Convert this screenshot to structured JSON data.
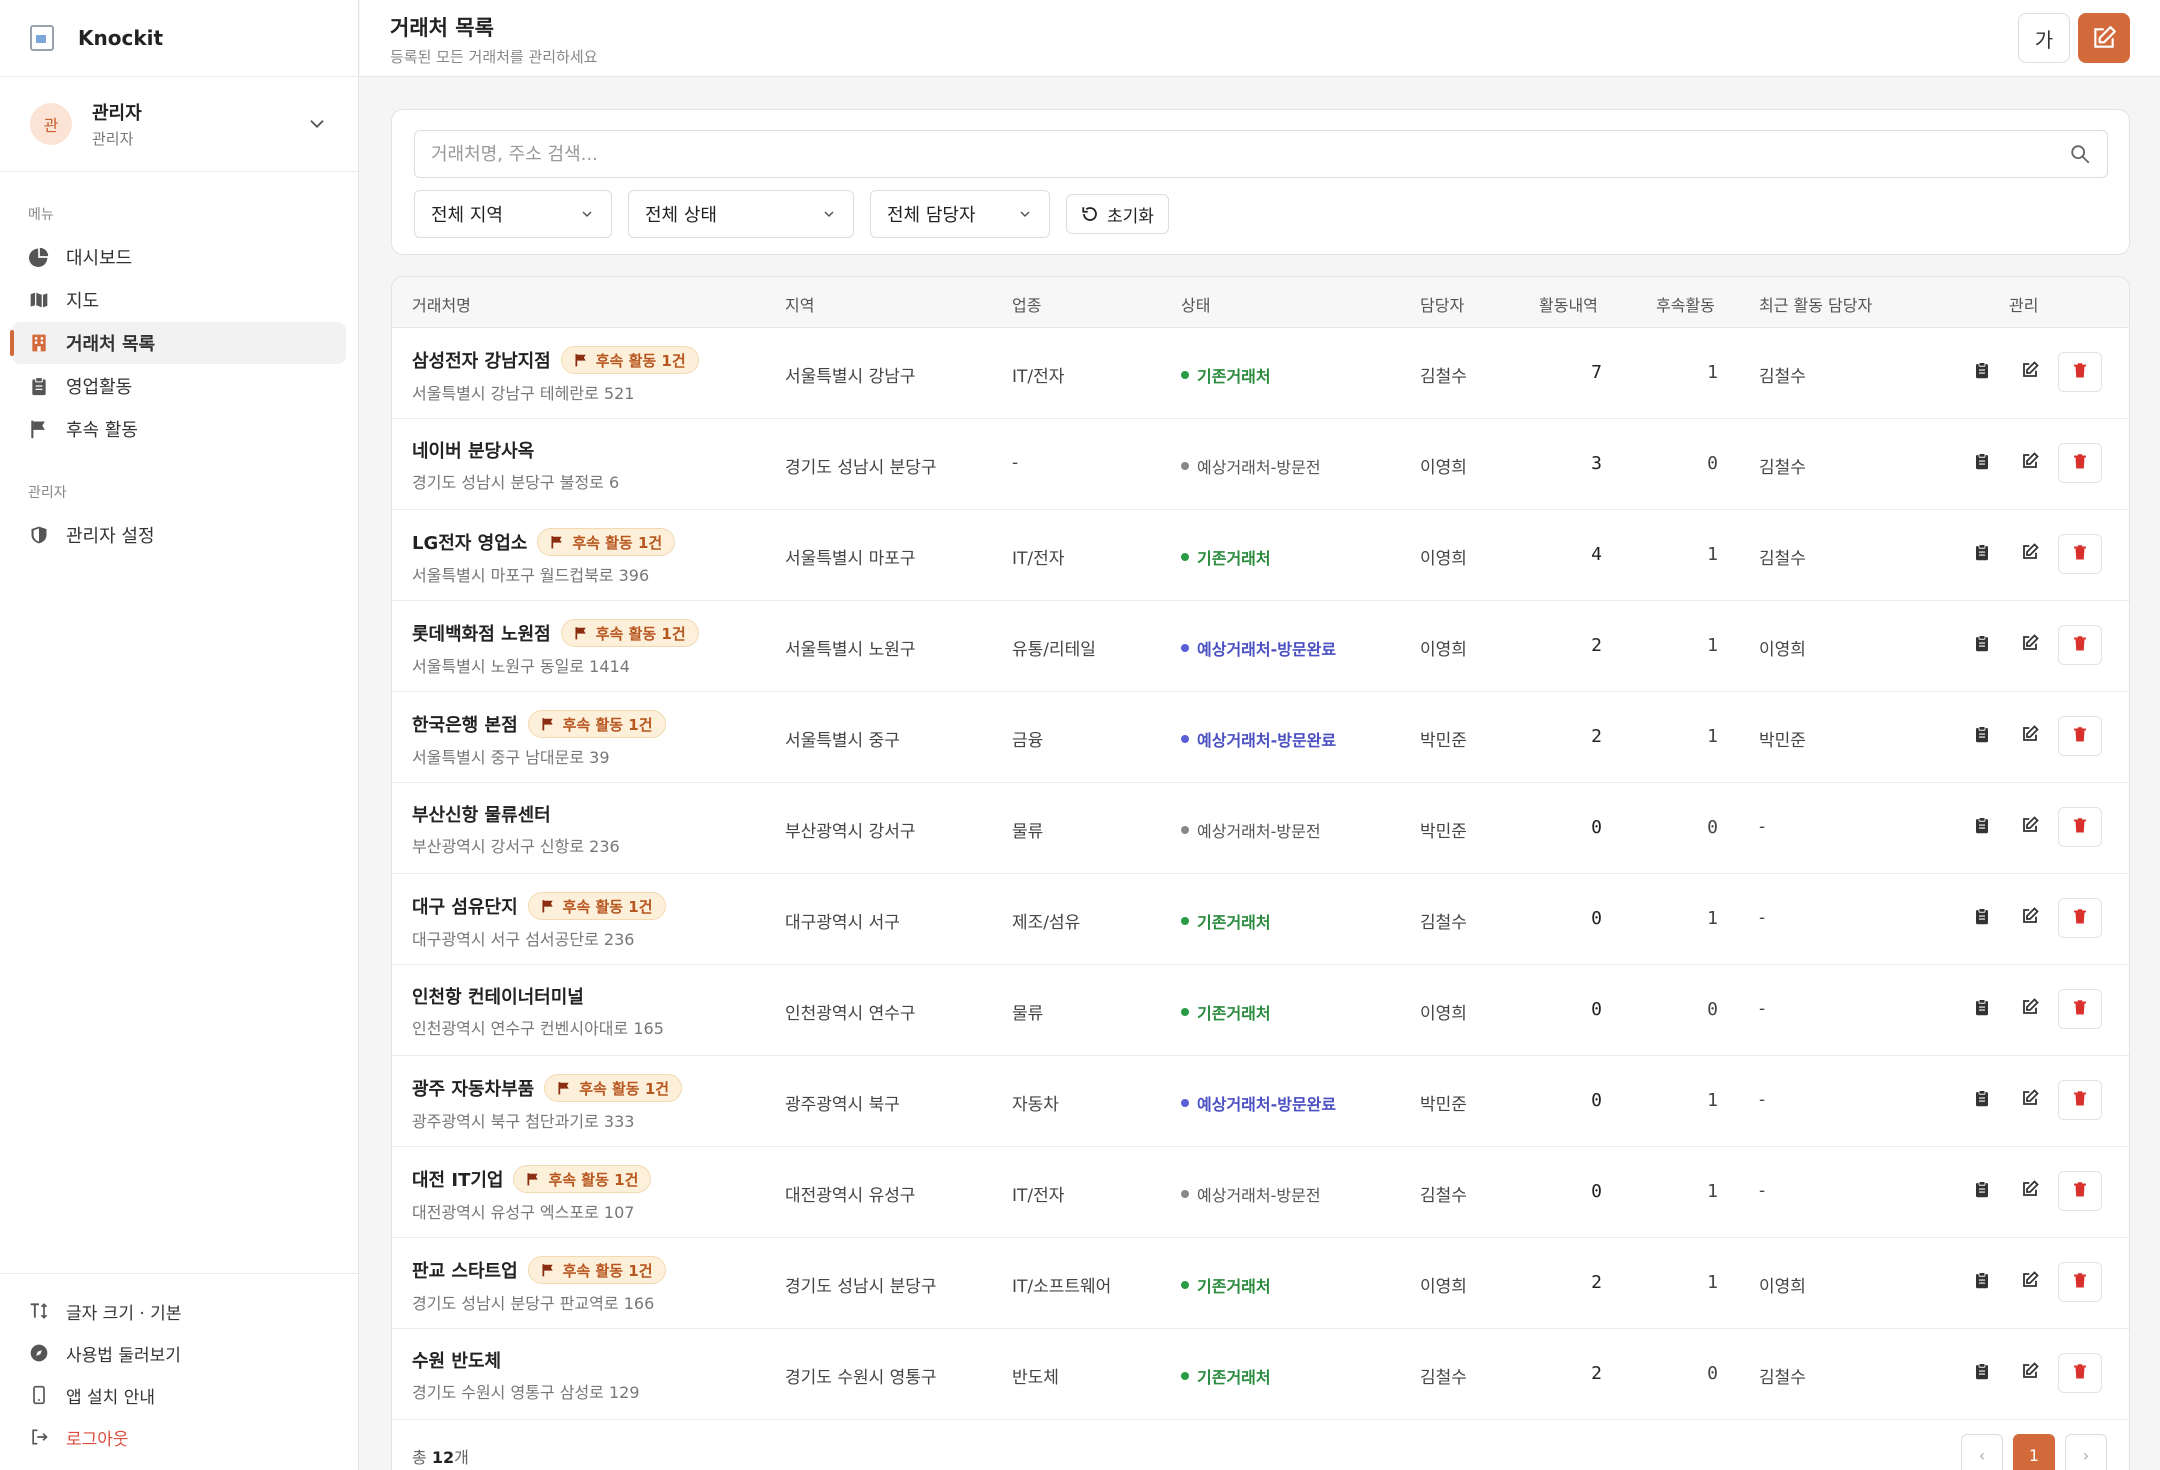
{
  "brand": {
    "name": "Knockit"
  },
  "user": {
    "avatar": "관",
    "name": "관리자",
    "role": "관리자"
  },
  "sidebar": {
    "menu_label": "메뉴",
    "admin_label": "관리자",
    "items": [
      {
        "label": "대시보드",
        "icon": "pie-chart-icon"
      },
      {
        "label": "지도",
        "icon": "map-icon"
      },
      {
        "label": "거래처 목록",
        "icon": "building-icon",
        "active": true
      },
      {
        "label": "영업활동",
        "icon": "clipboard-icon"
      },
      {
        "label": "후속 활동",
        "icon": "flag-icon"
      }
    ],
    "admin_items": [
      {
        "label": "관리자 설정",
        "icon": "shield-icon"
      }
    ],
    "bottom": [
      {
        "label": "글자 크기 · 기본",
        "icon": "text-size-icon"
      },
      {
        "label": "사용법 둘러보기",
        "icon": "compass-icon"
      },
      {
        "label": "앱 설치 안내",
        "icon": "phone-icon"
      },
      {
        "label": "로그아웃",
        "icon": "logout-icon"
      }
    ]
  },
  "header": {
    "title": "거래처 목록",
    "subtitle": "등록된 모든 거래처를 관리하세요",
    "font_button": "가"
  },
  "filters": {
    "search_placeholder": "거래처명, 주소 검색...",
    "region": "전체 지역",
    "status": "전체 상태",
    "manager": "전체 담당자",
    "reset": "초기화"
  },
  "table": {
    "columns": [
      "거래처명",
      "지역",
      "업종",
      "상태",
      "담당자",
      "활동내역",
      "후속활동",
      "최근 활동 담당자",
      "관리"
    ],
    "badge_text": "후속 활동 1건",
    "rows": [
      {
        "name": "삼성전자 강남지점",
        "badge": true,
        "address": "서울특별시 강남구 테헤란로 521",
        "region": "서울특별시 강남구",
        "industry": "IT/전자",
        "status": "기존거래처",
        "status_type": "green",
        "manager": "김철수",
        "activity": "7",
        "followup": "1",
        "recent": "김철수"
      },
      {
        "name": "네이버 분당사옥",
        "badge": false,
        "address": "경기도 성남시 분당구 불정로 6",
        "region": "경기도 성남시 분당구",
        "industry": "-",
        "status": "예상거래처-방문전",
        "status_type": "gray",
        "manager": "이영희",
        "activity": "3",
        "followup": "0",
        "recent": "김철수"
      },
      {
        "name": "LG전자 영업소",
        "badge": true,
        "address": "서울특별시 마포구 월드컵북로 396",
        "region": "서울특별시 마포구",
        "industry": "IT/전자",
        "status": "기존거래처",
        "status_type": "green",
        "manager": "이영희",
        "activity": "4",
        "followup": "1",
        "recent": "김철수"
      },
      {
        "name": "롯데백화점 노원점",
        "badge": true,
        "address": "서울특별시 노원구 동일로 1414",
        "region": "서울특별시 노원구",
        "industry": "유통/리테일",
        "status": "예상거래처-방문완료",
        "status_type": "blue",
        "manager": "이영희",
        "activity": "2",
        "followup": "1",
        "recent": "이영희"
      },
      {
        "name": "한국은행 본점",
        "badge": true,
        "address": "서울특별시 중구 남대문로 39",
        "region": "서울특별시 중구",
        "industry": "금융",
        "status": "예상거래처-방문완료",
        "status_type": "blue",
        "manager": "박민준",
        "activity": "2",
        "followup": "1",
        "recent": "박민준"
      },
      {
        "name": "부산신항 물류센터",
        "badge": false,
        "address": "부산광역시 강서구 신항로 236",
        "region": "부산광역시 강서구",
        "industry": "물류",
        "status": "예상거래처-방문전",
        "status_type": "gray",
        "manager": "박민준",
        "activity": "0",
        "followup": "0",
        "recent": "-"
      },
      {
        "name": "대구 섬유단지",
        "badge": true,
        "address": "대구광역시 서구 섬서공단로 236",
        "region": "대구광역시 서구",
        "industry": "제조/섬유",
        "status": "기존거래처",
        "status_type": "green",
        "manager": "김철수",
        "activity": "0",
        "followup": "1",
        "recent": "-"
      },
      {
        "name": "인천항 컨테이너터미널",
        "badge": false,
        "address": "인천광역시 연수구 컨벤시아대로 165",
        "region": "인천광역시 연수구",
        "industry": "물류",
        "status": "기존거래처",
        "status_type": "green",
        "manager": "이영희",
        "activity": "0",
        "followup": "0",
        "recent": "-"
      },
      {
        "name": "광주 자동차부품",
        "badge": true,
        "address": "광주광역시 북구 첨단과기로 333",
        "region": "광주광역시 북구",
        "industry": "자동차",
        "status": "예상거래처-방문완료",
        "status_type": "blue",
        "manager": "박민준",
        "activity": "0",
        "followup": "1",
        "recent": "-"
      },
      {
        "name": "대전 IT기업",
        "badge": true,
        "address": "대전광역시 유성구 엑스포로 107",
        "region": "대전광역시 유성구",
        "industry": "IT/전자",
        "status": "예상거래처-방문전",
        "status_type": "gray",
        "manager": "김철수",
        "activity": "0",
        "followup": "1",
        "recent": "-"
      },
      {
        "name": "판교 스타트업",
        "badge": true,
        "address": "경기도 성남시 분당구 판교역로 166",
        "region": "경기도 성남시 분당구",
        "industry": "IT/소프트웨어",
        "status": "기존거래처",
        "status_type": "green",
        "manager": "이영희",
        "activity": "2",
        "followup": "1",
        "recent": "이영희"
      },
      {
        "name": "수원 반도체",
        "badge": false,
        "address": "경기도 수원시 영통구 삼성로 129",
        "region": "경기도 수원시 영통구",
        "industry": "반도체",
        "status": "기존거래처",
        "status_type": "green",
        "manager": "김철수",
        "activity": "2",
        "followup": "0",
        "recent": "김철수"
      }
    ]
  },
  "footer": {
    "total_prefix": "총 ",
    "total_count": "12",
    "total_suffix": "개",
    "current_page": "1",
    "prev": "‹",
    "next": "›"
  },
  "colors": {
    "accent": "#d36a3c",
    "green": "#2a8b3e",
    "blue": "#4a4fc2",
    "danger": "#d9302c"
  }
}
